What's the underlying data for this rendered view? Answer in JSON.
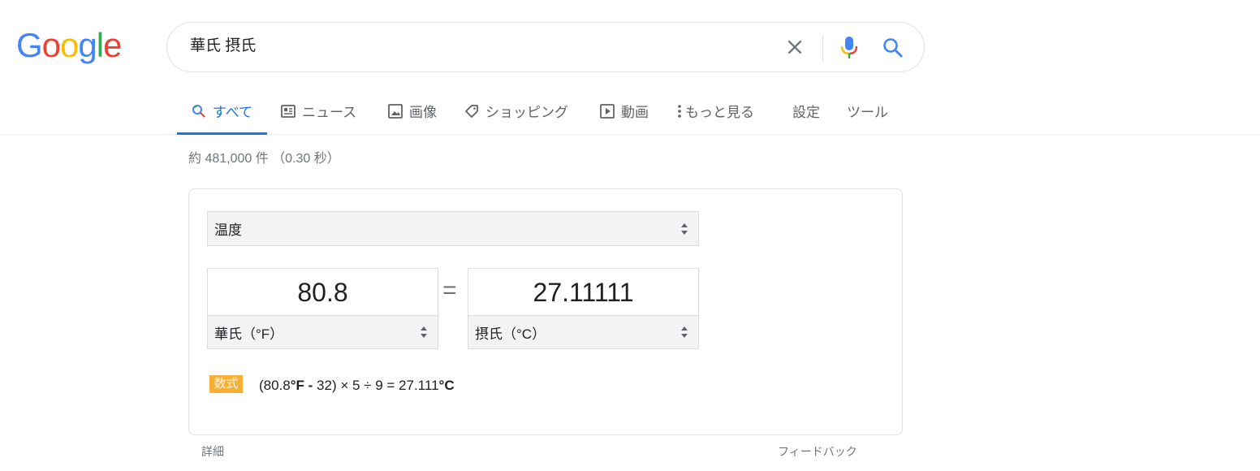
{
  "logo": {
    "letters": [
      "G",
      "o",
      "o",
      "g",
      "l",
      "e"
    ],
    "colors": [
      "#4285F4",
      "#EA4335",
      "#FBBC05",
      "#4285F4",
      "#34A853",
      "#EA4335"
    ]
  },
  "search": {
    "query": "華氏 摂氏",
    "clear_icon": "close-icon",
    "mic_icon": "microphone-icon",
    "search_icon": "search-icon"
  },
  "tabs": [
    {
      "label": "すべて",
      "icon": "search-icon"
    },
    {
      "label": "ニュース",
      "icon": "news-icon"
    },
    {
      "label": "画像",
      "icon": "image-icon"
    },
    {
      "label": "ショッピング",
      "icon": "tag-icon"
    },
    {
      "label": "動画",
      "icon": "play-icon"
    },
    {
      "label": "もっと見る",
      "icon": "more-vert-icon"
    },
    {
      "label": "設定"
    },
    {
      "label": "ツール"
    }
  ],
  "stats": "約 481,000 件 （0.30 秒）",
  "converter": {
    "category": "温度",
    "left_value": "80.8",
    "left_unit": "華氏（°F）",
    "equals": "=",
    "right_value": "27.11111",
    "right_unit": "摂氏（°C）",
    "formula_label": "数式",
    "formula": {
      "part1": "(80.8",
      "unit1": "°F",
      "part2": " - ",
      "part3": "32) × 5 ÷ 9 = 27.111",
      "unit2": "°C"
    }
  },
  "footer": {
    "detail": "詳細",
    "feedback": "フィードバック"
  },
  "colors": {
    "accent": "#1a73e8",
    "formula_badge": "#f6ae35"
  }
}
